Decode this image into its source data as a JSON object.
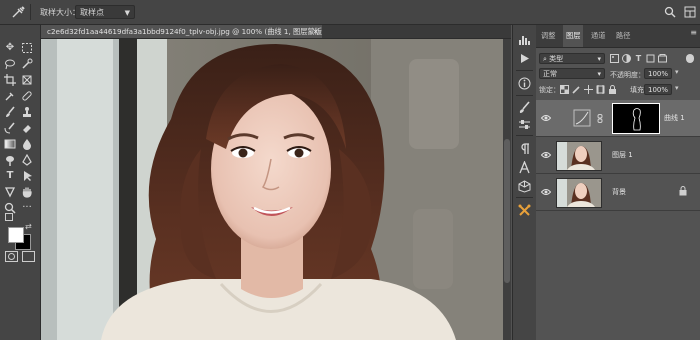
{
  "options_bar": {
    "tool_icon": "eyedropper-icon",
    "sample_size_label": "取样大小：",
    "sample_size_value": "取样点",
    "icons": [
      "search-icon",
      "workspace-grid-icon"
    ]
  },
  "document": {
    "tab_title": "c2e6d32fd1aa44619dfa3a1bbd9124f0_tplv-obj.jpg @ 100% (曲线 1, 图层蒙版/8) *",
    "close_glyph": "×"
  },
  "left_tools": [
    "move-icon",
    "marquee-icon",
    "lasso-icon",
    "quick-select-icon",
    "crop-icon",
    "frame-icon",
    "eyedropper-icon",
    "healing-icon",
    "brush-icon",
    "stamp-icon",
    "history-brush-icon",
    "eraser-icon",
    "gradient-icon",
    "blur-icon",
    "dodge-icon",
    "pen-icon",
    "type-icon",
    "path-select-icon",
    "shape-icon",
    "hand-icon",
    "zoom-icon",
    "edit-toolbar-icon"
  ],
  "type_tool_glyph": "T",
  "mid_icons": [
    "histogram-icon",
    "actions-play-icon",
    "info-icon",
    "brush-settings-icon",
    "adjust-sliders-icon",
    "paragraph-icon",
    "character-icon",
    "3d-icon",
    "tool-presets-icon"
  ],
  "layers_panel": {
    "tabs": [
      "调整",
      "图层",
      "通道",
      "路径"
    ],
    "active_tab": "图层",
    "filter_value": "类型",
    "blend_mode": "正常",
    "opacity_label": "不透明度：",
    "opacity_value": "100%",
    "lock_label": "锁定：",
    "fill_label": "填充：",
    "fill_value": "100%",
    "layers": [
      {
        "name": "曲线 1",
        "selected": true
      },
      {
        "name": "图层 1",
        "selected": false
      },
      {
        "name": "背景",
        "selected": false
      }
    ]
  },
  "colors": {
    "accent": "#e8a13a",
    "foreground": "#ffffff",
    "background": "#000000"
  }
}
